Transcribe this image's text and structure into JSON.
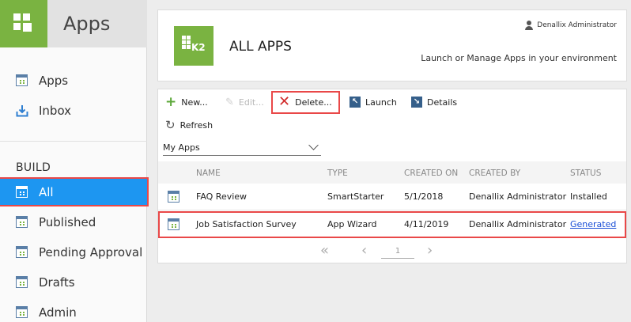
{
  "sidebar": {
    "title": "Apps",
    "top_items": [
      {
        "label": "Apps",
        "icon": "app-grid-icon"
      },
      {
        "label": "Inbox",
        "icon": "inbox-download-icon"
      }
    ],
    "section_label": "BUILD",
    "build_items": [
      {
        "label": "All",
        "icon": "app-grid-icon",
        "active": true
      },
      {
        "label": "Published",
        "icon": "app-grid-icon"
      },
      {
        "label": "Pending Approval",
        "icon": "app-grid-icon"
      },
      {
        "label": "Drafts",
        "icon": "app-grid-icon"
      },
      {
        "label": "Admin",
        "icon": "app-grid-icon"
      }
    ]
  },
  "header": {
    "logo_text": "K2",
    "title": "ALL APPS",
    "user_name": "Denallix Administrator",
    "subtitle": "Launch or Manage Apps in your environment"
  },
  "toolbar": {
    "new_label": "New...",
    "edit_label": "Edit...",
    "delete_label": "Delete...",
    "launch_label": "Launch",
    "details_label": "Details",
    "refresh_label": "Refresh"
  },
  "filter": {
    "selected": "My Apps"
  },
  "table": {
    "columns": [
      "NAME",
      "TYPE",
      "CREATED ON",
      "CREATED BY",
      "STATUS"
    ],
    "rows": [
      {
        "name": "FAQ Review",
        "type": "SmartStarter",
        "created_on": "5/1/2018",
        "created_by": "Denallix Administrator",
        "status": "Installed"
      },
      {
        "name": "Job Satisfaction Survey",
        "type": "App Wizard",
        "created_on": "4/11/2019",
        "created_by": "Denallix Administrator",
        "status": "Generated"
      }
    ]
  },
  "pager": {
    "first": "«",
    "prev": "‹",
    "page": "1",
    "next": "›"
  },
  "colors": {
    "brand_green": "#7ab341",
    "active_blue": "#1d96f1",
    "highlight_red": "#e94848",
    "link_blue": "#1a4fd6"
  }
}
